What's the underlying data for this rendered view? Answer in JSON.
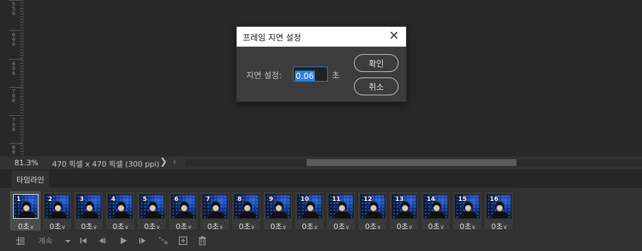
{
  "ruler": {
    "labels": [
      "5\n5\n0",
      "6\n0\n0",
      "6\n5\n0",
      "7\n0\n0",
      "7\n5\n0",
      "8\n0"
    ]
  },
  "status": {
    "zoom": "81.3%",
    "doc_info": "470 픽셀 x 470 픽셀 (300 ppi)",
    "arrow": "❯",
    "scroll_left": "‹"
  },
  "panel": {
    "tab_label": "타임라인"
  },
  "frames": [
    {
      "num": "1",
      "delay": "0초"
    },
    {
      "num": "2",
      "delay": "0초"
    },
    {
      "num": "3",
      "delay": "0초"
    },
    {
      "num": "4",
      "delay": "0초"
    },
    {
      "num": "5",
      "delay": "0초"
    },
    {
      "num": "6",
      "delay": "0초"
    },
    {
      "num": "7",
      "delay": "0초"
    },
    {
      "num": "8",
      "delay": "0초"
    },
    {
      "num": "9",
      "delay": "0초"
    },
    {
      "num": "10",
      "delay": "0초"
    },
    {
      "num": "11",
      "delay": "0초"
    },
    {
      "num": "12",
      "delay": "0초"
    },
    {
      "num": "13",
      "delay": "0초"
    },
    {
      "num": "14",
      "delay": "0초"
    },
    {
      "num": "15",
      "delay": "0초"
    },
    {
      "num": "16",
      "delay": "0초"
    }
  ],
  "selected_frame": 1,
  "controls": {
    "loop_label": "계속",
    "icons": [
      "convert-to-video-timeline-icon",
      "loop-dropdown-icon",
      "first-frame-icon",
      "previous-frame-icon",
      "play-icon",
      "next-frame-icon",
      "tween-icon",
      "new-frame-icon",
      "delete-frame-icon"
    ]
  },
  "dialog": {
    "title": "프레임 지연 설정",
    "close_glyph": "✕",
    "delay_label": "지연 설정:",
    "delay_value": "0.06",
    "delay_unit": "초",
    "ok_label": "확인",
    "cancel_label": "취소"
  },
  "colors": {
    "selection": "#2f7fe0",
    "panel_bg": "#323232",
    "canvas_bg": "#282828"
  }
}
